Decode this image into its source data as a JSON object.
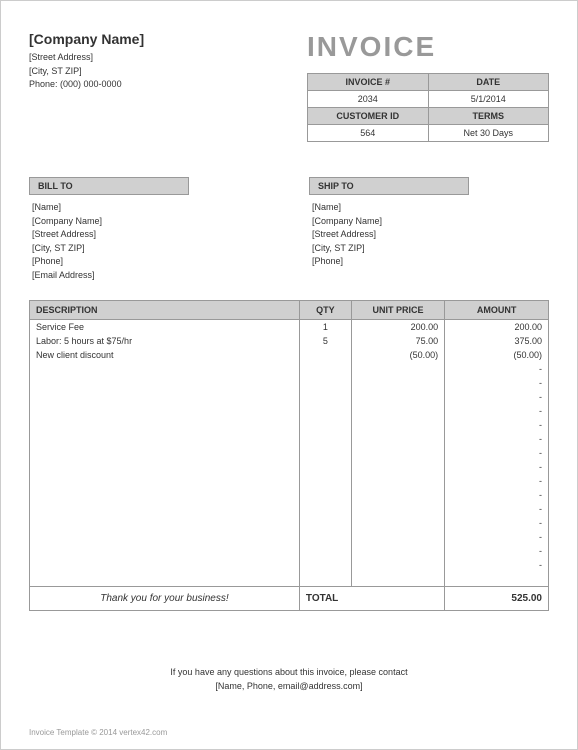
{
  "header": {
    "company_name": "[Company Name]",
    "street": "[Street Address]",
    "city": "[City, ST  ZIP]",
    "phone": "Phone: (000) 000-0000",
    "title": "INVOICE"
  },
  "meta": {
    "invoice_no_label": "INVOICE #",
    "invoice_no": "2034",
    "date_label": "DATE",
    "date": "5/1/2014",
    "customer_id_label": "CUSTOMER ID",
    "customer_id": "564",
    "terms_label": "TERMS",
    "terms": "Net 30 Days"
  },
  "bill_to": {
    "header": "BILL TO",
    "name": "[Name]",
    "company": "[Company Name]",
    "street": "[Street Address]",
    "city": "[City, ST  ZIP]",
    "phone": "[Phone]",
    "email": "[Email Address]"
  },
  "ship_to": {
    "header": "SHIP TO",
    "name": "[Name]",
    "company": "[Company Name]",
    "street": "[Street Address]",
    "city": "[City, ST  ZIP]",
    "phone": "[Phone]"
  },
  "table": {
    "desc_header": "DESCRIPTION",
    "qty_header": "QTY",
    "price_header": "UNIT PRICE",
    "amt_header": "AMOUNT"
  },
  "items": {
    "0": {
      "desc": "Service Fee",
      "qty": "1",
      "price": "200.00",
      "amt": "200.00"
    },
    "1": {
      "desc": "Labor: 5 hours at $75/hr",
      "qty": "5",
      "price": "75.00",
      "amt": "375.00"
    },
    "2": {
      "desc": "New client discount",
      "qty": "",
      "price": "(50.00)",
      "amt": "(50.00)"
    },
    "dash": "-"
  },
  "total": {
    "thanks": "Thank you for your business!",
    "label": "TOTAL",
    "value": "525.00"
  },
  "footer": {
    "line1": "If you have any questions about this invoice, please contact",
    "line2": "[Name, Phone, email@address.com]"
  },
  "copyright": "Invoice Template © 2014 vertex42.com"
}
